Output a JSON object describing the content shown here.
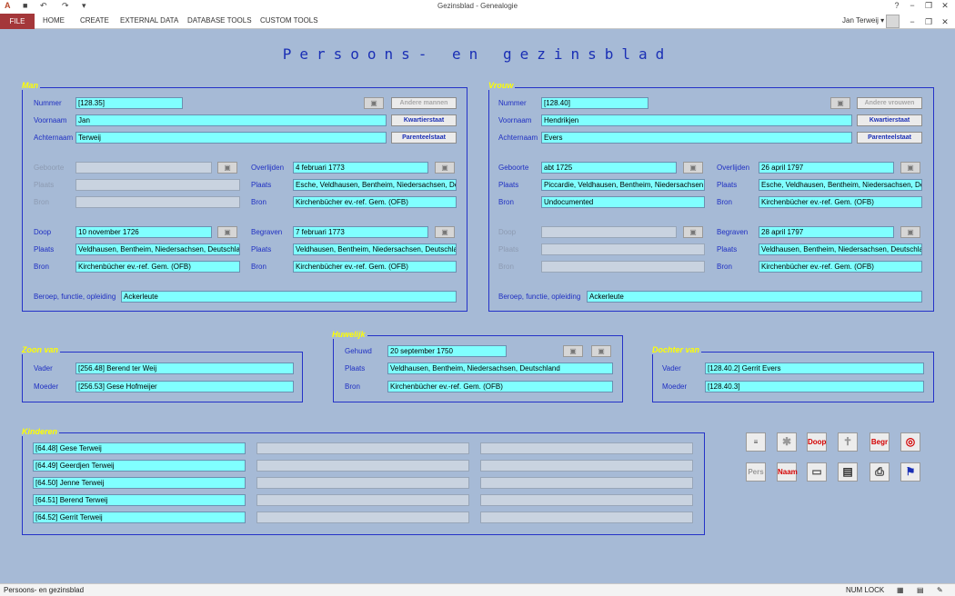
{
  "window": {
    "title": "Gezinsblad - Genealogie",
    "quick_access": [
      "A",
      "■",
      "↶",
      "↷",
      "▾"
    ],
    "controls": [
      "?",
      "−",
      "❐",
      "✕"
    ],
    "doc_controls": [
      "−",
      "❐",
      "✕"
    ]
  },
  "ribbon": {
    "file": "FILE",
    "tabs": [
      "HOME",
      "CREATE",
      "EXTERNAL DATA",
      "DATABASE TOOLS",
      "CUSTOM TOOLS"
    ],
    "user": "Jan Terweij ▾"
  },
  "form": {
    "title": "Persoons- en gezinsblad"
  },
  "man": {
    "group_title": "Man",
    "nummer_label": "Nummer",
    "nummer": "[128.35]",
    "voornaam_label": "Voornaam",
    "voornaam": "Jan",
    "achternaam_label": "Achternaam",
    "achternaam": "Terweij",
    "andere_btn": "Andere mannen",
    "kwartier_btn": "Kwartierstaat",
    "parenteel_btn": "Parenteelstaat",
    "geboorte_label": "Geboorte",
    "geboorte": "",
    "plaats_label": "Plaats",
    "geboorte_plaats": "",
    "bron_label": "Bron",
    "geboorte_bron": "",
    "overlijden_label": "Overlijden",
    "overlijden": "4 februari 1773",
    "overlijden_plaats": "Esche, Veldhausen, Bentheim, Niedersachsen, De",
    "overlijden_bron": "Kirchenbücher ev.-ref. Gem. (OFB)",
    "doop_label": "Doop",
    "doop": "10 november 1726",
    "doop_plaats": "Veldhausen, Bentheim, Niedersachsen, Deutschla",
    "doop_bron": "Kirchenbücher ev.-ref. Gem. (OFB)",
    "begraven_label": "Begraven",
    "begraven": "7 februari 1773",
    "begraven_plaats": "Veldhausen, Bentheim, Niedersachsen, Deutschla",
    "begraven_bron": "Kirchenbücher ev.-ref. Gem. (OFB)",
    "beroep_label": "Beroep, functie, opleiding",
    "beroep": "Ackerleute"
  },
  "vrouw": {
    "group_title": "Vrouw",
    "nummer_label": "Nummer",
    "nummer": "[128.40]",
    "voornaam_label": "Voornaam",
    "voornaam": "Hendrikjen",
    "achternaam_label": "Achternaam",
    "achternaam": "Evers",
    "andere_btn": "Andere vrouwen",
    "kwartier_btn": "Kwartierstaat",
    "parenteel_btn": "Parenteelstaat",
    "geboorte_label": "Geboorte",
    "geboorte": "abt 1725",
    "plaats_label": "Plaats",
    "geboorte_plaats": "Piccardie, Veldhausen, Bentheim, Niedersachsen,",
    "bron_label": "Bron",
    "geboorte_bron": "Undocumented",
    "overlijden_label": "Overlijden",
    "overlijden": "26 april 1797",
    "overlijden_plaats": "Esche, Veldhausen, Bentheim, Niedersachsen, De",
    "overlijden_bron": "Kirchenbücher ev.-ref. Gem. (OFB)",
    "doop_label": "Doop",
    "doop": "",
    "doop_plaats": "",
    "doop_bron": "",
    "begraven_label": "Begraven",
    "begraven": "28 april 1797",
    "begraven_plaats": "Veldhausen, Bentheim, Niedersachsen, Deutschla",
    "begraven_bron": "Kirchenbücher ev.-ref. Gem. (OFB)",
    "beroep_label": "Beroep, functie, opleiding",
    "beroep": "Ackerleute"
  },
  "zoon_van": {
    "group_title": "Zoon van",
    "vader_label": "Vader",
    "vader": "[256.48] Berend ter Weij",
    "moeder_label": "Moeder",
    "moeder": "[256.53] Gese Hofmeijer"
  },
  "huwelijk": {
    "group_title": "Huwelijk",
    "gehuwd_label": "Gehuwd",
    "gehuwd": "20 september 1750",
    "plaats_label": "Plaats",
    "plaats": "Veldhausen, Bentheim, Niedersachsen, Deutschland",
    "bron_label": "Bron",
    "bron": "Kirchenbücher ev.-ref. Gem. (OFB)"
  },
  "dochter_van": {
    "group_title": "Dochter van",
    "vader_label": "Vader",
    "vader": "[128.40.2] Gerrit Evers",
    "moeder_label": "Moeder",
    "moeder": "[128.40.3]"
  },
  "kinderen": {
    "group_title": "Kinderen",
    "items": [
      "[64.48] Gese Terweij",
      "[64.49] Geerdjen Terweij",
      "[64.50] Jenne Terweij",
      "[64.51] Berend Terweij",
      "[64.52] Gerrit Terweij"
    ]
  },
  "toolbar": {
    "doop": "Doop",
    "begr": "Begr",
    "pers": "Pers",
    "naam": "Naam",
    "star": "✱",
    "cross": "✝"
  },
  "icons": {
    "camera": "▣",
    "rings": "◎",
    "print": "⎙",
    "preview": "▤",
    "report": "≡",
    "card": "▭",
    "flag": "⚑"
  },
  "statusbar": {
    "left": "Persoons- en gezinsblad",
    "numlock": "NUM LOCK"
  },
  "colors": {
    "field": "#80ffff",
    "label": "#1f2fc2",
    "group_title": "#ffff00",
    "background": "#a6bad6"
  }
}
